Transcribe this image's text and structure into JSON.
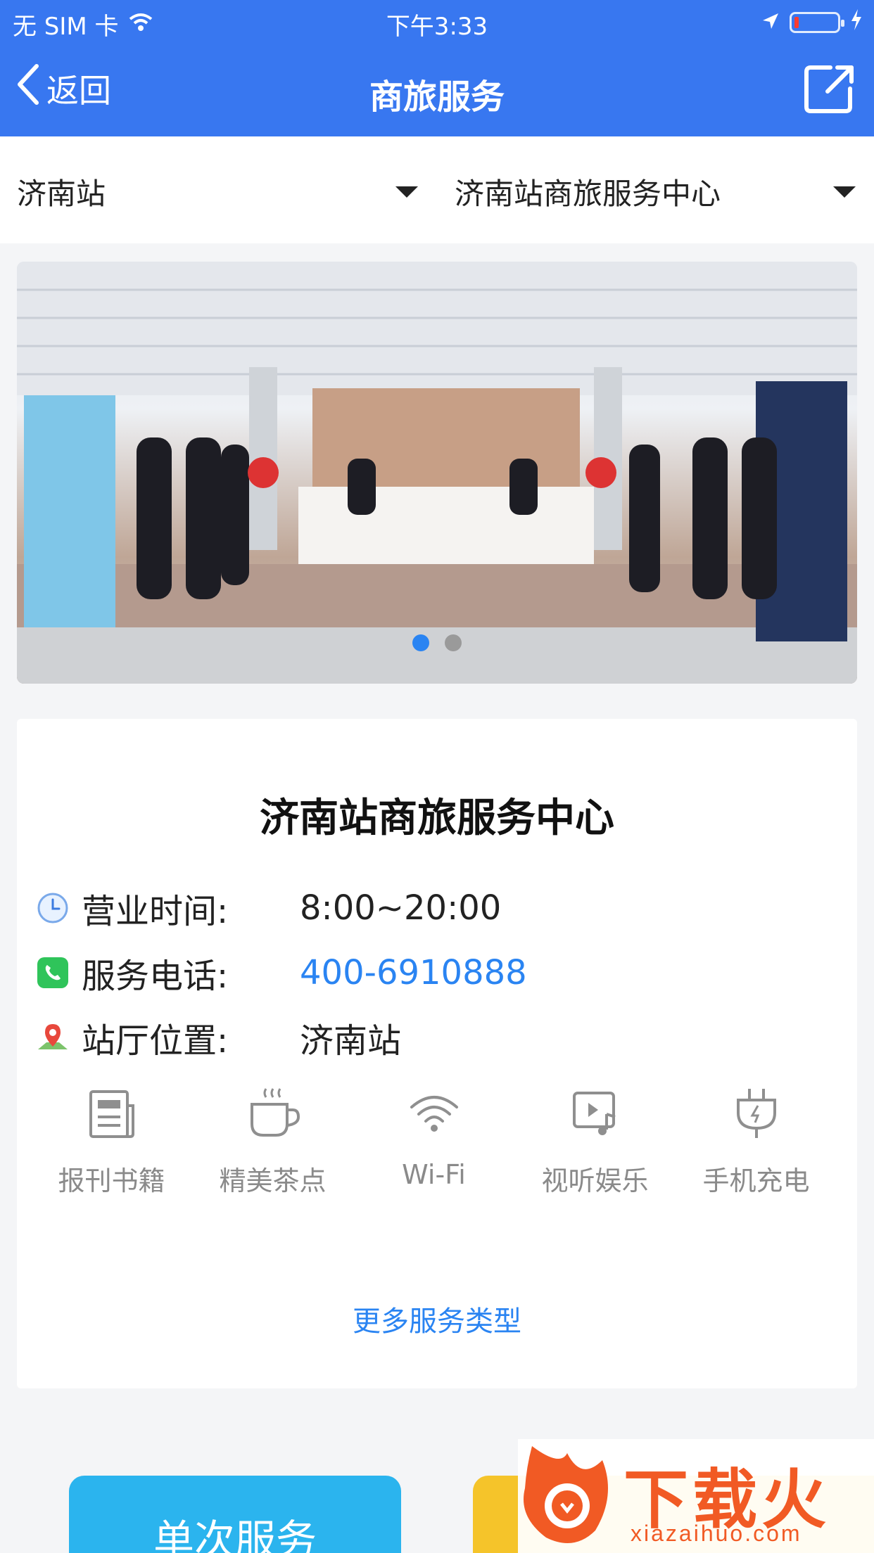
{
  "status_bar": {
    "carrier": "无 SIM 卡",
    "time": "下午3:33"
  },
  "nav": {
    "back_label": "返回",
    "title": "商旅服务"
  },
  "filters": {
    "station": "济南站",
    "center": "济南站商旅服务中心"
  },
  "banner": {
    "slides": 2,
    "active_slide": 1
  },
  "detail": {
    "name": "济南站商旅服务中心",
    "hours": {
      "label": "营业时间:",
      "value": "8:00~20:00"
    },
    "phone": {
      "label": "服务电话:",
      "value": "400-6910888"
    },
    "location": {
      "label": "站厅位置:",
      "value": "济南站"
    },
    "amenities": [
      {
        "label": "报刊书籍",
        "icon": "newspaper-icon"
      },
      {
        "label": "精美茶点",
        "icon": "teacup-icon"
      },
      {
        "label": "Wi-Fi",
        "icon": "wifi-icon"
      },
      {
        "label": "视听娱乐",
        "icon": "media-icon"
      },
      {
        "label": "手机充电",
        "icon": "charging-plug-icon"
      }
    ],
    "more_label": "更多服务类型"
  },
  "actions": {
    "single_service": "单次服务"
  },
  "watermark": {
    "brand": "下载火",
    "domain": "xiazaihuo.com"
  },
  "colors": {
    "brand_blue": "#3877f0",
    "link_blue": "#2a84f2",
    "button_cyan": "#2bb4ee",
    "button_yellow": "#f5c42a"
  }
}
